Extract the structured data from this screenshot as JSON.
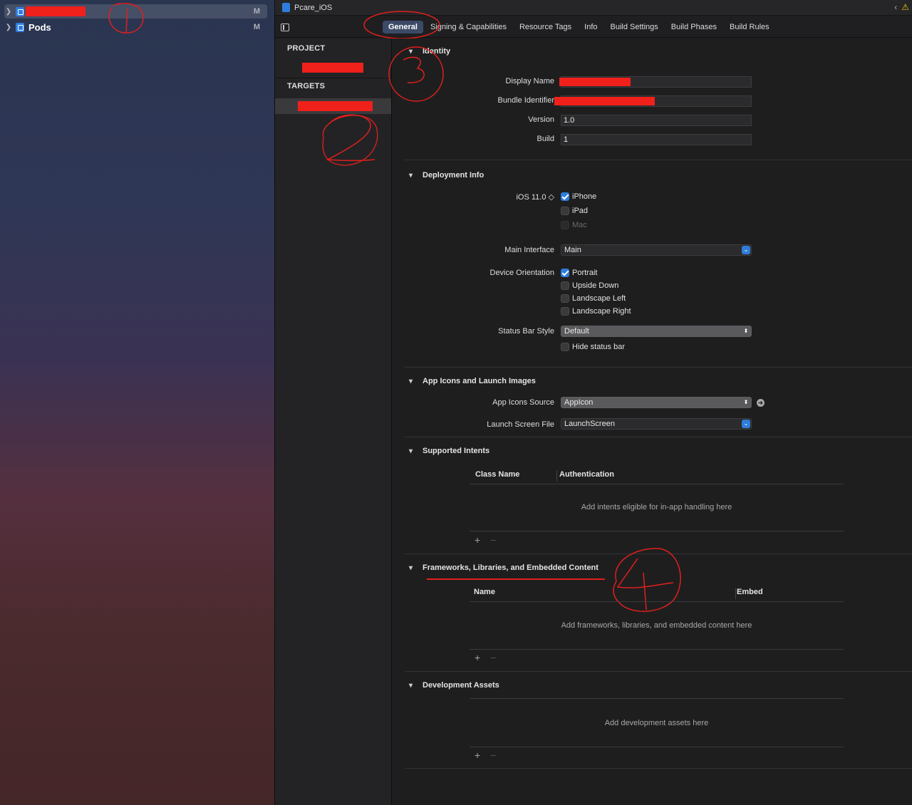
{
  "navigator": {
    "items": [
      {
        "label": "",
        "badge": "M",
        "selected": true
      },
      {
        "label": "Pods",
        "badge": "M",
        "selected": false
      }
    ]
  },
  "editor": {
    "file_title": "Pcare_iOS",
    "tabs": [
      "General",
      "Signing & Capabilities",
      "Resource Tags",
      "Info",
      "Build Settings",
      "Build Phases",
      "Build Rules"
    ],
    "active_tab": "General"
  },
  "target_list": {
    "project_header": "PROJECT",
    "targets_header": "TARGETS"
  },
  "identity": {
    "title": "Identity",
    "display_name_label": "Display Name",
    "display_name_value": "",
    "bundle_id_label": "Bundle Identifier",
    "bundle_id_value": "",
    "version_label": "Version",
    "version_value": "1.0",
    "build_label": "Build",
    "build_value": "1"
  },
  "deployment": {
    "title": "Deployment Info",
    "ios_label": "iOS 11.0 ◇",
    "devices": [
      {
        "label": "iPhone",
        "checked": true,
        "enabled": true
      },
      {
        "label": "iPad",
        "checked": false,
        "enabled": true
      },
      {
        "label": "Mac",
        "checked": false,
        "enabled": false
      }
    ],
    "main_interface_label": "Main Interface",
    "main_interface_value": "Main",
    "orientation_label": "Device Orientation",
    "orientations": [
      {
        "label": "Portrait",
        "checked": true
      },
      {
        "label": "Upside Down",
        "checked": false
      },
      {
        "label": "Landscape Left",
        "checked": false
      },
      {
        "label": "Landscape Right",
        "checked": false
      }
    ],
    "status_bar_label": "Status Bar Style",
    "status_bar_value": "Default",
    "hide_status_bar_label": "Hide status bar"
  },
  "app_icons": {
    "title": "App Icons and Launch Images",
    "source_label": "App Icons Source",
    "source_value": "AppIcon",
    "launch_label": "Launch Screen File",
    "launch_value": "LaunchScreen"
  },
  "intents": {
    "title": "Supported Intents",
    "col_class": "Class Name",
    "col_auth": "Authentication",
    "empty": "Add intents eligible for in-app handling here"
  },
  "frameworks": {
    "title": "Frameworks, Libraries, and Embedded Content",
    "col_name": "Name",
    "col_embed": "Embed",
    "empty": "Add frameworks, libraries, and embedded content here"
  },
  "dev_assets": {
    "title": "Development Assets",
    "empty": "Add development assets here"
  },
  "controls": {
    "plus": "+",
    "minus": "−"
  },
  "colors": {
    "accent": "#2f7ddb",
    "redaction": "#f0201b",
    "annotation": "#e0201c"
  }
}
